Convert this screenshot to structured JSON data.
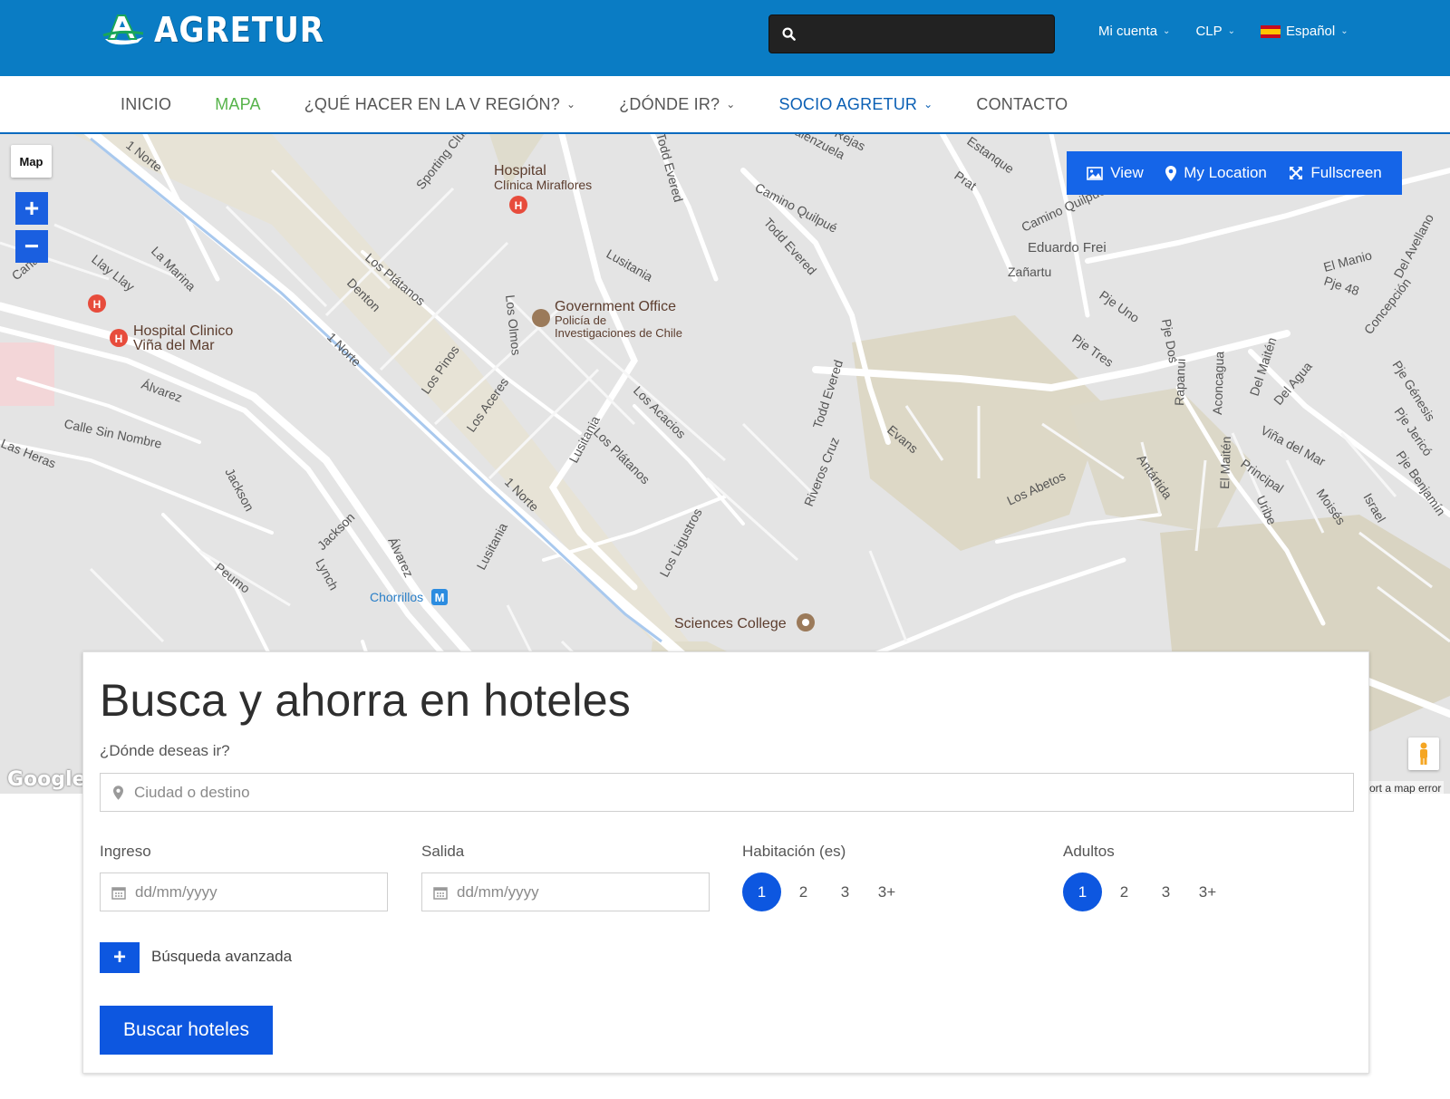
{
  "header": {
    "brand": "AGRETUR",
    "search": {
      "value": "",
      "placeholder": ""
    },
    "account_label": "Mi cuenta",
    "currency_label": "CLP",
    "language_label": "Español"
  },
  "nav": {
    "items": [
      {
        "label": "INICIO",
        "dropdown": false
      },
      {
        "label": "MAPA",
        "dropdown": false
      },
      {
        "label": "¿QUÉ HACER EN LA V REGIÓN?",
        "dropdown": true
      },
      {
        "label": "¿DÓNDE IR?",
        "dropdown": true
      },
      {
        "label": "SOCIO AGRETUR",
        "dropdown": true
      },
      {
        "label": "CONTACTO",
        "dropdown": false
      }
    ]
  },
  "map": {
    "type_label": "Map",
    "tools": {
      "view": "View",
      "my_location": "My Location",
      "fullscreen": "Fullscreen"
    },
    "report_label": "ort a map error",
    "google_label": "Google",
    "labels": {
      "hospital_miraflores_1": "Hospital",
      "hospital_miraflores_2": "Clínica Miraflores",
      "gov_office_1": "Government Office",
      "gov_office_2": "Policía de",
      "gov_office_3": "Investigaciones de Chile",
      "hospital_vina_1": "Hospital Clinico",
      "hospital_vina_2": "Viña del Mar",
      "chorrillos": "Chorrillos",
      "sciences_college": "Sciences College",
      "norte_1": "1 Norte",
      "norte_2": "1 Norte",
      "norte_3": "1 Norte",
      "sporting": "Sporting Club",
      "llay": "Llay Llay",
      "marina": "La Marina",
      "platanos": "Los Plátanos",
      "platanos2": "Los Plátanos",
      "denton": "Denton",
      "olmos": "Los Olmos",
      "pinos": "Los Pinos",
      "aceres": "Los Aceres",
      "acacios": "Los Acacios",
      "lusitania1": "Lusitania",
      "lusitania2": "Lusitania",
      "lusitania3": "Lusitania",
      "alvarez1": "Álvarez",
      "alvarez2": "Álvarez",
      "sin_nombre": "Calle Sin Nombre",
      "las_heras": "Las Heras",
      "jackson1": "Jackson",
      "jackson2": "Jackson",
      "lynch": "Lynch",
      "peumo": "Peumo",
      "ligustros": "Los Ligustros",
      "todd1": "Todd Evered",
      "todd2": "Todd Evered",
      "todd3": "Todd Evered",
      "quilpue": "Camino Quilpué",
      "quilpue2": "Camino Quilpué",
      "eduardo_frei": "Eduardo Frei",
      "zanartu": "Zañartu",
      "rivero": "Riveros Cruz",
      "evans": "Evans",
      "abetos": "Los Abetos",
      "estanque": "Estanque",
      "prat": "Prat",
      "pje_uno": "Pje Uno",
      "pje_dos": "Pje Dos",
      "pje_tres": "Pje Tres",
      "rapanui": "Rapanui",
      "aconcagua": "Aconcagua",
      "maiten1": "Del Maitén",
      "maiten2": "El Maitén",
      "del_agua": "Del Agua",
      "antartida": "Antártida",
      "vina_mar": "Viña del Mar",
      "principal": "Principal",
      "uribe": "Uribe",
      "moises": "Moisés",
      "israel": "Israel",
      "el_manio": "El Manio",
      "pje48": "Pje 48",
      "concepcion": "Concepción",
      "genesis": "Pje Génesis",
      "jerico": "Pje Jericó",
      "benjamin": "Pje Benjamín",
      "avellano": "Del Avellano",
      "valenzuela": "alenzuela",
      "rejas": "Rejas",
      "canal": "Canal"
    }
  },
  "search_panel": {
    "title": "Busca y ahorra en hoteles",
    "destination_label": "¿Dónde deseas ir?",
    "destination": {
      "value": "",
      "placeholder": "Ciudad o destino"
    },
    "checkin_label": "Ingreso",
    "checkin": {
      "value": "",
      "placeholder": "dd/mm/yyyy"
    },
    "checkout_label": "Salida",
    "checkout": {
      "value": "",
      "placeholder": "dd/mm/yyyy"
    },
    "rooms_label": "Habitación (es)",
    "rooms_options": [
      "1",
      "2",
      "3",
      "3+"
    ],
    "rooms_selected": "1",
    "adults_label": "Adultos",
    "adults_options": [
      "1",
      "2",
      "3",
      "3+"
    ],
    "adults_selected": "1",
    "advanced_label": "Búsqueda avanzada",
    "submit_label": "Buscar hoteles"
  },
  "colors": {
    "header_bg": "#0a7cc4",
    "primary_blue": "#0d57e0",
    "nav_active": "#56b34a",
    "nav_socio": "#0a5fb4"
  }
}
